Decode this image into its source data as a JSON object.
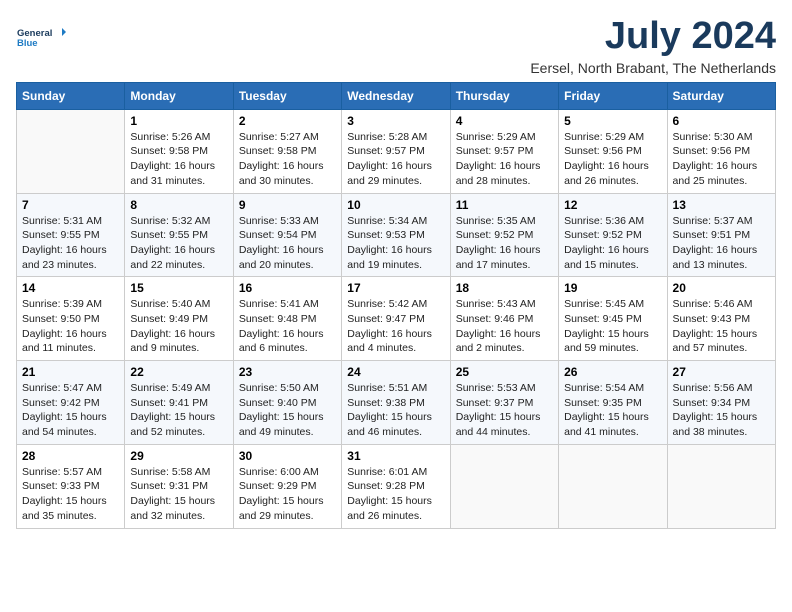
{
  "logo": {
    "line1": "General",
    "line2": "Blue"
  },
  "header": {
    "title": "July 2024",
    "subtitle": "Eersel, North Brabant, The Netherlands"
  },
  "days": [
    "Sunday",
    "Monday",
    "Tuesday",
    "Wednesday",
    "Thursday",
    "Friday",
    "Saturday"
  ],
  "weeks": [
    [
      {
        "num": "",
        "lines": []
      },
      {
        "num": "1",
        "lines": [
          "Sunrise: 5:26 AM",
          "Sunset: 9:58 PM",
          "Daylight: 16 hours",
          "and 31 minutes."
        ]
      },
      {
        "num": "2",
        "lines": [
          "Sunrise: 5:27 AM",
          "Sunset: 9:58 PM",
          "Daylight: 16 hours",
          "and 30 minutes."
        ]
      },
      {
        "num": "3",
        "lines": [
          "Sunrise: 5:28 AM",
          "Sunset: 9:57 PM",
          "Daylight: 16 hours",
          "and 29 minutes."
        ]
      },
      {
        "num": "4",
        "lines": [
          "Sunrise: 5:29 AM",
          "Sunset: 9:57 PM",
          "Daylight: 16 hours",
          "and 28 minutes."
        ]
      },
      {
        "num": "5",
        "lines": [
          "Sunrise: 5:29 AM",
          "Sunset: 9:56 PM",
          "Daylight: 16 hours",
          "and 26 minutes."
        ]
      },
      {
        "num": "6",
        "lines": [
          "Sunrise: 5:30 AM",
          "Sunset: 9:56 PM",
          "Daylight: 16 hours",
          "and 25 minutes."
        ]
      }
    ],
    [
      {
        "num": "7",
        "lines": [
          "Sunrise: 5:31 AM",
          "Sunset: 9:55 PM",
          "Daylight: 16 hours",
          "and 23 minutes."
        ]
      },
      {
        "num": "8",
        "lines": [
          "Sunrise: 5:32 AM",
          "Sunset: 9:55 PM",
          "Daylight: 16 hours",
          "and 22 minutes."
        ]
      },
      {
        "num": "9",
        "lines": [
          "Sunrise: 5:33 AM",
          "Sunset: 9:54 PM",
          "Daylight: 16 hours",
          "and 20 minutes."
        ]
      },
      {
        "num": "10",
        "lines": [
          "Sunrise: 5:34 AM",
          "Sunset: 9:53 PM",
          "Daylight: 16 hours",
          "and 19 minutes."
        ]
      },
      {
        "num": "11",
        "lines": [
          "Sunrise: 5:35 AM",
          "Sunset: 9:52 PM",
          "Daylight: 16 hours",
          "and 17 minutes."
        ]
      },
      {
        "num": "12",
        "lines": [
          "Sunrise: 5:36 AM",
          "Sunset: 9:52 PM",
          "Daylight: 16 hours",
          "and 15 minutes."
        ]
      },
      {
        "num": "13",
        "lines": [
          "Sunrise: 5:37 AM",
          "Sunset: 9:51 PM",
          "Daylight: 16 hours",
          "and 13 minutes."
        ]
      }
    ],
    [
      {
        "num": "14",
        "lines": [
          "Sunrise: 5:39 AM",
          "Sunset: 9:50 PM",
          "Daylight: 16 hours",
          "and 11 minutes."
        ]
      },
      {
        "num": "15",
        "lines": [
          "Sunrise: 5:40 AM",
          "Sunset: 9:49 PM",
          "Daylight: 16 hours",
          "and 9 minutes."
        ]
      },
      {
        "num": "16",
        "lines": [
          "Sunrise: 5:41 AM",
          "Sunset: 9:48 PM",
          "Daylight: 16 hours",
          "and 6 minutes."
        ]
      },
      {
        "num": "17",
        "lines": [
          "Sunrise: 5:42 AM",
          "Sunset: 9:47 PM",
          "Daylight: 16 hours",
          "and 4 minutes."
        ]
      },
      {
        "num": "18",
        "lines": [
          "Sunrise: 5:43 AM",
          "Sunset: 9:46 PM",
          "Daylight: 16 hours",
          "and 2 minutes."
        ]
      },
      {
        "num": "19",
        "lines": [
          "Sunrise: 5:45 AM",
          "Sunset: 9:45 PM",
          "Daylight: 15 hours",
          "and 59 minutes."
        ]
      },
      {
        "num": "20",
        "lines": [
          "Sunrise: 5:46 AM",
          "Sunset: 9:43 PM",
          "Daylight: 15 hours",
          "and 57 minutes."
        ]
      }
    ],
    [
      {
        "num": "21",
        "lines": [
          "Sunrise: 5:47 AM",
          "Sunset: 9:42 PM",
          "Daylight: 15 hours",
          "and 54 minutes."
        ]
      },
      {
        "num": "22",
        "lines": [
          "Sunrise: 5:49 AM",
          "Sunset: 9:41 PM",
          "Daylight: 15 hours",
          "and 52 minutes."
        ]
      },
      {
        "num": "23",
        "lines": [
          "Sunrise: 5:50 AM",
          "Sunset: 9:40 PM",
          "Daylight: 15 hours",
          "and 49 minutes."
        ]
      },
      {
        "num": "24",
        "lines": [
          "Sunrise: 5:51 AM",
          "Sunset: 9:38 PM",
          "Daylight: 15 hours",
          "and 46 minutes."
        ]
      },
      {
        "num": "25",
        "lines": [
          "Sunrise: 5:53 AM",
          "Sunset: 9:37 PM",
          "Daylight: 15 hours",
          "and 44 minutes."
        ]
      },
      {
        "num": "26",
        "lines": [
          "Sunrise: 5:54 AM",
          "Sunset: 9:35 PM",
          "Daylight: 15 hours",
          "and 41 minutes."
        ]
      },
      {
        "num": "27",
        "lines": [
          "Sunrise: 5:56 AM",
          "Sunset: 9:34 PM",
          "Daylight: 15 hours",
          "and 38 minutes."
        ]
      }
    ],
    [
      {
        "num": "28",
        "lines": [
          "Sunrise: 5:57 AM",
          "Sunset: 9:33 PM",
          "Daylight: 15 hours",
          "and 35 minutes."
        ]
      },
      {
        "num": "29",
        "lines": [
          "Sunrise: 5:58 AM",
          "Sunset: 9:31 PM",
          "Daylight: 15 hours",
          "and 32 minutes."
        ]
      },
      {
        "num": "30",
        "lines": [
          "Sunrise: 6:00 AM",
          "Sunset: 9:29 PM",
          "Daylight: 15 hours",
          "and 29 minutes."
        ]
      },
      {
        "num": "31",
        "lines": [
          "Sunrise: 6:01 AM",
          "Sunset: 9:28 PM",
          "Daylight: 15 hours",
          "and 26 minutes."
        ]
      },
      {
        "num": "",
        "lines": []
      },
      {
        "num": "",
        "lines": []
      },
      {
        "num": "",
        "lines": []
      }
    ]
  ]
}
